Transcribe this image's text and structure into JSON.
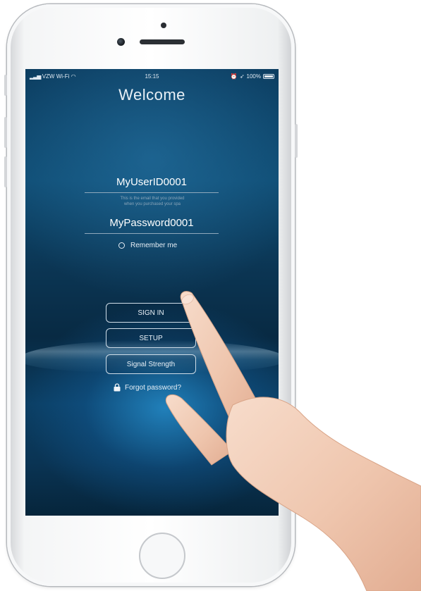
{
  "status_bar": {
    "carrier": "VZW Wi-Fi",
    "time": "15:15",
    "battery": "100%",
    "battery_level": 1.0
  },
  "screen": {
    "title": "Welcome",
    "username_value": "MyUserID0001",
    "username_hint_line1": "This is the email that you provided",
    "username_hint_line2": "when you purchased your spa",
    "password_value": "MyPassword0001",
    "remember_label": "Remember me",
    "sign_in_label": "SIGN IN",
    "setup_label": "SETUP",
    "signal_label": "Signal Strength",
    "forgot_label": "Forgot password?"
  },
  "colors": {
    "screen_top": "#0c3d60",
    "screen_bottom": "#06253b",
    "text": "#e8f0f6",
    "hand_skin": "#f2cdb8"
  }
}
